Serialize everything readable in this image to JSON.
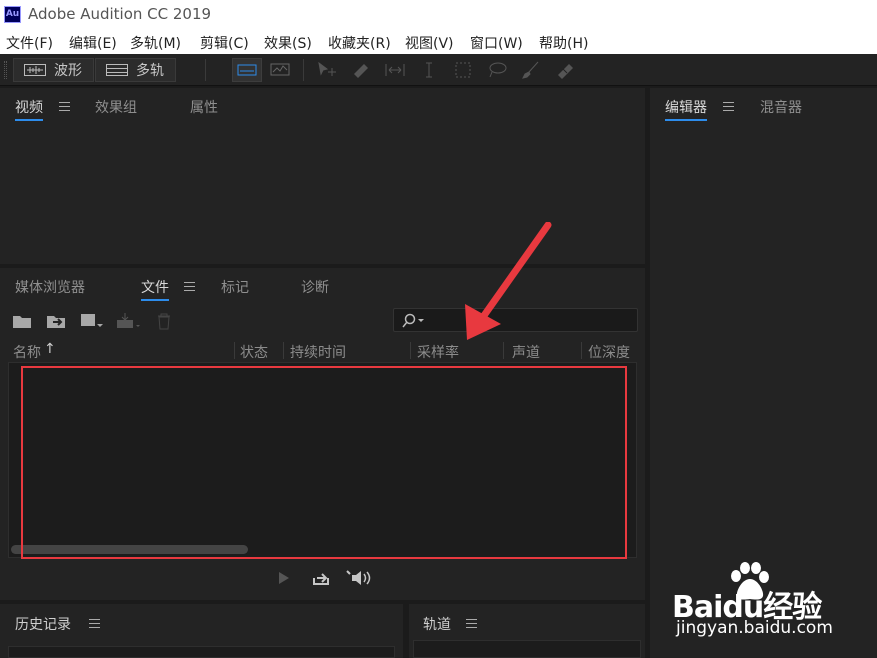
{
  "titlebar": {
    "logo": "Au",
    "title": "Adobe Audition CC 2019"
  },
  "menu": [
    "文件(F)",
    "编辑(E)",
    "多轨(M)",
    "剪辑(C)",
    "效果(S)",
    "收藏夹(R)",
    "视图(V)",
    "窗口(W)",
    "帮助(H)"
  ],
  "toolbar": {
    "waveform_label": "波形",
    "multitrack_label": "多轨"
  },
  "top_panel": {
    "tabs": [
      "视频",
      "效果组",
      "属性"
    ]
  },
  "right_panel": {
    "tabs": [
      "编辑器",
      "混音器"
    ]
  },
  "files_panel": {
    "tabs": [
      "媒体浏览器",
      "文件",
      "标记",
      "诊断"
    ],
    "search_placeholder": "",
    "columns": [
      "名称",
      "状态",
      "持续时间",
      "采样率",
      "声道",
      "位深度"
    ],
    "sort_indicator": "↑"
  },
  "bottom_left": {
    "tab": "历史记录"
  },
  "bottom_right": {
    "tab": "轨道"
  },
  "watermark": {
    "brand": "Baidu经验",
    "url": "jingyan.baidu.com"
  },
  "annotation_color": "#e8393f",
  "accent_color": "#2d8ceb"
}
